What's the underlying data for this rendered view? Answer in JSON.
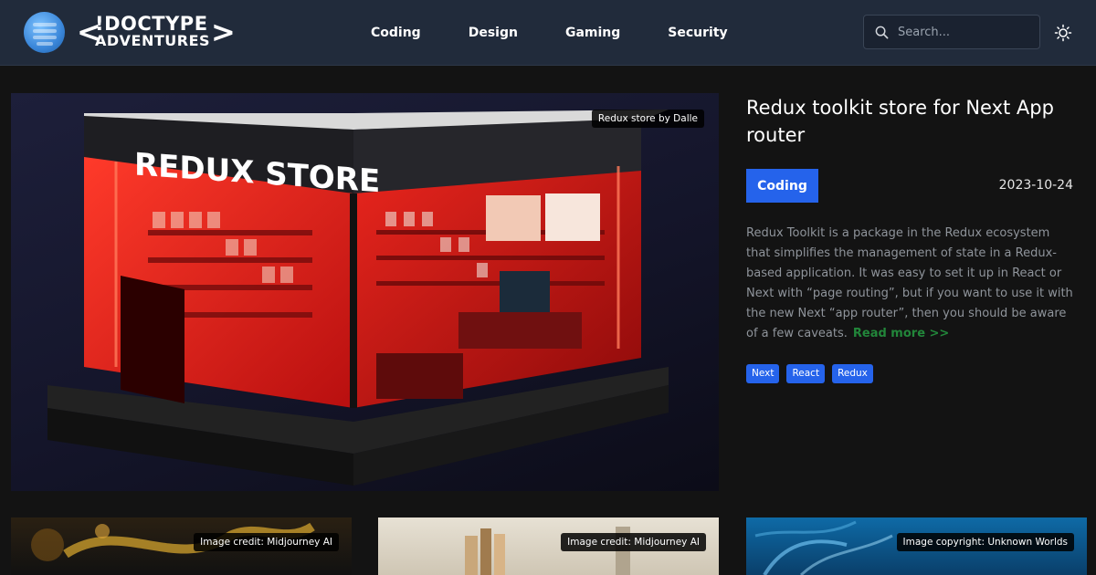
{
  "header": {
    "logo_line1": "!DOCTYPE",
    "logo_line2": "ADVENTURES",
    "nav": [
      "Coding",
      "Design",
      "Gaming",
      "Security"
    ],
    "search_placeholder": "Search..."
  },
  "hero": {
    "image_credit": "Redux store by Dalle",
    "store_sign": "REDUX STORE",
    "title": "Redux toolkit store for Next App router",
    "category": "Coding",
    "date": "2023-10-24",
    "description": "Redux Toolkit is a package in the Redux ecosystem that simplifies the management of state in a Redux-based application. It was easy to set it up in React or Next with “page routing”, but if you want to use it with the new Next “app router”, then you should be aware of a few caveats.",
    "read_more": "Read more >>",
    "tags": [
      "Next",
      "React",
      "Redux"
    ]
  },
  "cards": [
    {
      "credit": "Image credit: Midjourney AI"
    },
    {
      "credit": "Image credit: Midjourney AI"
    },
    {
      "credit": "Image copyright: Unknown Worlds"
    }
  ],
  "colors": {
    "header_bg": "#212b3b",
    "page_bg": "#131313",
    "accent_blue": "#2563eb",
    "read_more_green": "#22863a"
  },
  "icons": {
    "search": "search-icon",
    "theme": "sun-icon"
  }
}
